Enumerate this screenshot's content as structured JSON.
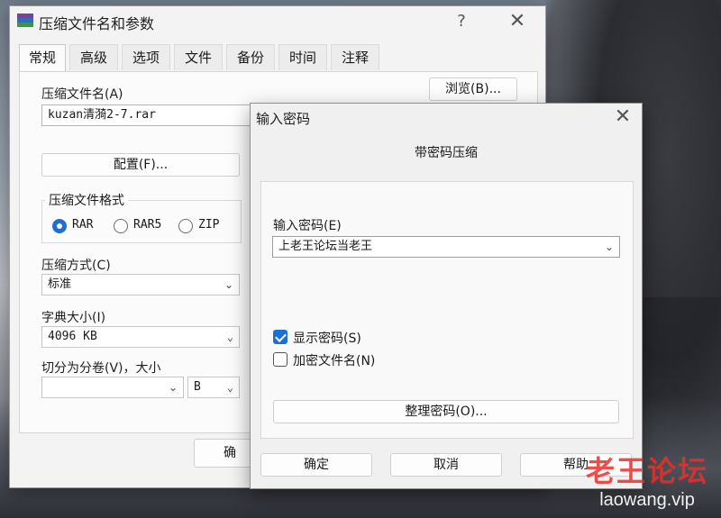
{
  "main_dialog": {
    "title": "压缩文件名和参数",
    "help": "?",
    "close": "✕",
    "tabs": [
      "常规",
      "高级",
      "选项",
      "文件",
      "备份",
      "时间",
      "注释"
    ],
    "archive_name_label": "压缩文件名(A)",
    "archive_name_value": "kuzan清漪2-7.rar",
    "browse_button": "浏览(B)...",
    "profiles_button": "配置(F)...",
    "format_group_title": "压缩文件格式",
    "formats": [
      {
        "label": "RAR",
        "selected": true
      },
      {
        "label": "RAR5",
        "selected": false
      },
      {
        "label": "ZIP",
        "selected": false
      }
    ],
    "method_label": "压缩方式(C)",
    "method_value": "标准",
    "dict_label": "字典大小(I)",
    "dict_value": "4096 KB",
    "split_label": "切分为分卷(V)，大小",
    "split_value": "",
    "split_unit": "B",
    "ok_button_partial": "确"
  },
  "password_dialog": {
    "title": "输入密码",
    "close": "✕",
    "caption": "带密码压缩",
    "enter_label": "输入密码(E)",
    "password_value": "上老王论坛当老王",
    "show_password": {
      "label": "显示密码(S)",
      "checked": true
    },
    "encrypt_names": {
      "label": "加密文件名(N)",
      "checked": false
    },
    "organize_button": "整理密码(O)...",
    "ok_button": "确定",
    "cancel_button": "取消",
    "help_button": "帮助"
  },
  "watermark": {
    "line1": "老王论坛",
    "line2": "laowang.vip"
  },
  "colors": {
    "accent": "#1f6fd1",
    "watermark_red": "#e8302c"
  }
}
